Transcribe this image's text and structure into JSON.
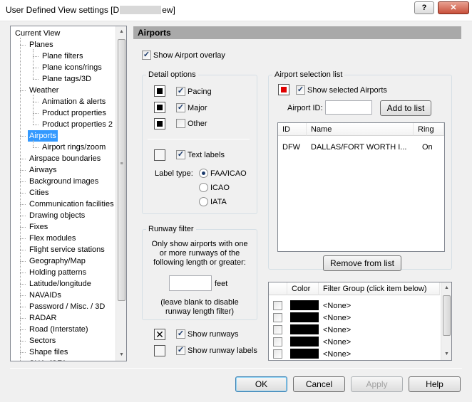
{
  "window": {
    "title_prefix": "User Defined View settings  [D",
    "title_suffix": "ew]",
    "help_glyph": "?",
    "close_glyph": "✕"
  },
  "tree": {
    "items": [
      {
        "label": "Current View",
        "level": 0
      },
      {
        "label": "Planes",
        "level": 1
      },
      {
        "label": "Plane filters",
        "level": 2
      },
      {
        "label": "Plane icons/rings",
        "level": 2
      },
      {
        "label": "Plane tags/3D",
        "level": 2
      },
      {
        "label": "Weather",
        "level": 1
      },
      {
        "label": "Animation & alerts",
        "level": 2
      },
      {
        "label": "Product properties",
        "level": 2
      },
      {
        "label": "Product properties 2",
        "level": 2
      },
      {
        "label": "Airports",
        "level": 1,
        "selected": true
      },
      {
        "label": "Airport rings/zoom",
        "level": 2
      },
      {
        "label": "Airspace boundaries",
        "level": 1
      },
      {
        "label": "Airways",
        "level": 1
      },
      {
        "label": "Background images",
        "level": 1
      },
      {
        "label": "Cities",
        "level": 1
      },
      {
        "label": "Communication facilities",
        "level": 1
      },
      {
        "label": "Drawing objects",
        "level": 1
      },
      {
        "label": "Fixes",
        "level": 1
      },
      {
        "label": "Flex modules",
        "level": 1
      },
      {
        "label": "Flight service stations",
        "level": 1
      },
      {
        "label": "Geography/Map",
        "level": 1
      },
      {
        "label": "Holding patterns",
        "level": 1
      },
      {
        "label": "Latitude/longitude",
        "level": 1
      },
      {
        "label": "NAVAIDs",
        "level": 1
      },
      {
        "label": "Password / Misc. / 3D",
        "level": 1
      },
      {
        "label": "RADAR",
        "level": 1
      },
      {
        "label": "Road (Interstate)",
        "level": 1
      },
      {
        "label": "Sectors",
        "level": 1
      },
      {
        "label": "Shape files",
        "level": 1
      },
      {
        "label": "SUAs/CFAs",
        "level": 1
      }
    ]
  },
  "panel": {
    "header": "Airports",
    "show_overlay": {
      "label": "Show Airport overlay",
      "checked": true
    }
  },
  "detail": {
    "title": "Detail options",
    "rows": [
      {
        "label": "Pacing",
        "checked": true
      },
      {
        "label": "Major",
        "checked": true
      },
      {
        "label": "Other",
        "checked": false
      }
    ],
    "text_labels": {
      "label": "Text labels",
      "checked": true
    },
    "label_type": "Label type:",
    "radios": [
      {
        "label": "FAA/ICAO",
        "checked": true
      },
      {
        "label": "ICAO",
        "checked": false
      },
      {
        "label": "IATA",
        "checked": false
      }
    ]
  },
  "runway": {
    "title": "Runway filter",
    "desc1": "Only show airports with one",
    "desc2": "or more runways of the",
    "desc3": "following length or greater:",
    "value": "",
    "unit": "feet",
    "note1": "(leave blank to disable",
    "note2": "runway length filter)",
    "show_runways": {
      "label": "Show runways",
      "checked": true
    },
    "show_runway_labels": {
      "label": "Show runway labels",
      "checked": true
    }
  },
  "selection": {
    "title": "Airport selection list",
    "show_selected": {
      "label": "Show selected Airports",
      "checked": true
    },
    "swatch_color": "#e00000",
    "id_label": "Airport ID:",
    "id_value": "",
    "add_button": "Add to list",
    "columns": [
      "ID",
      "Name",
      "Ring"
    ],
    "rows": [
      {
        "id": "DFW",
        "name": "DALLAS/FORT WORTH I...",
        "ring": "On"
      }
    ],
    "remove_button": "Remove from list"
  },
  "filters": {
    "columns": [
      "Color",
      "Filter Group (click item below)"
    ],
    "rows": [
      {
        "name": "<None>",
        "color": "#000000"
      },
      {
        "name": "<None>",
        "color": "#000000"
      },
      {
        "name": "<None>",
        "color": "#000000"
      },
      {
        "name": "<None>",
        "color": "#000000"
      },
      {
        "name": "<None>",
        "color": "#000000"
      }
    ]
  },
  "footer": {
    "ok": "OK",
    "cancel": "Cancel",
    "apply": "Apply",
    "help": "Help"
  }
}
